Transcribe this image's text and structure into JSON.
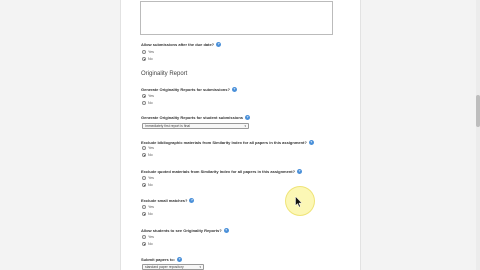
{
  "questions": [
    {
      "label": "Allow submissions after the due date?",
      "options": [
        "Yes",
        "No"
      ],
      "selected": 1
    },
    {
      "label": "Generate Originality Reports for submissions?",
      "options": [
        "Yes",
        "No"
      ],
      "selected": 0
    },
    {
      "label": "Generate Originality Reports for student submissions",
      "select_value": "Immediately first report is final"
    },
    {
      "label": "Exclude bibliographic materials from Similarity Index for all papers in this assignment?",
      "options": [
        "Yes",
        "No"
      ],
      "selected": 1
    },
    {
      "label": "Exclude quoted materials from Similarity Index for all papers in this assignment?",
      "options": [
        "Yes",
        "No"
      ],
      "selected": 1
    },
    {
      "label": "Exclude small matches?",
      "options": [
        "Yes",
        "No"
      ],
      "selected": 1
    },
    {
      "label": "Allow students to see Originality Reports?",
      "options": [
        "Yes",
        "No"
      ],
      "selected": 1
    },
    {
      "label": "Submit papers to:",
      "select_value": "standard paper repository"
    }
  ],
  "section_title": "Originality Report",
  "colors": {
    "help_icon": "#4a90d9",
    "cursor_highlight": "#faf078"
  }
}
